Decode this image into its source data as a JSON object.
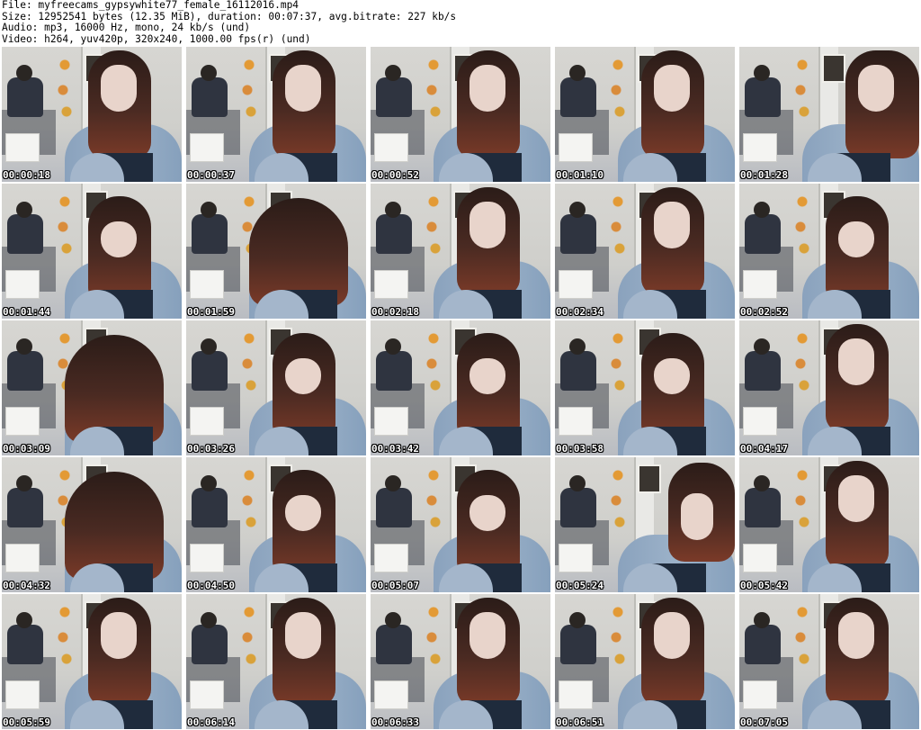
{
  "header": {
    "file": "File: myfreecams_gypsywhite77_female_16112016.mp4",
    "size": "Size: 12952541 bytes (12.35 MiB), duration: 00:07:37, avg.bitrate: 227 kb/s",
    "audio": "Audio: mp3, 16000 Hz, mono, 24 kb/s (und)",
    "video": "Video: h264, yuv420p, 320x240, 1000.00 fps(r) (und)"
  },
  "thumbnails": [
    {
      "time": "00:00:18"
    },
    {
      "time": "00:00:37"
    },
    {
      "time": "00:00:52"
    },
    {
      "time": "00:01:10"
    },
    {
      "time": "00:01:28"
    },
    {
      "time": "00:01:44"
    },
    {
      "time": "00:01:59"
    },
    {
      "time": "00:02:18"
    },
    {
      "time": "00:02:34"
    },
    {
      "time": "00:02:52"
    },
    {
      "time": "00:03:09"
    },
    {
      "time": "00:03:26"
    },
    {
      "time": "00:03:42"
    },
    {
      "time": "00:03:58"
    },
    {
      "time": "00:04:17"
    },
    {
      "time": "00:04:32"
    },
    {
      "time": "00:04:50"
    },
    {
      "time": "00:05:07"
    },
    {
      "time": "00:05:24"
    },
    {
      "time": "00:05:42"
    },
    {
      "time": "00:05:59"
    },
    {
      "time": "00:06:14"
    },
    {
      "time": "00:06:33"
    },
    {
      "time": "00:06:51"
    },
    {
      "time": "00:07:05"
    }
  ],
  "colors": {
    "background": "#ffffff",
    "header_text": "#000000",
    "timestamp_text": "#ffffff",
    "timestamp_outline": "#000000"
  }
}
